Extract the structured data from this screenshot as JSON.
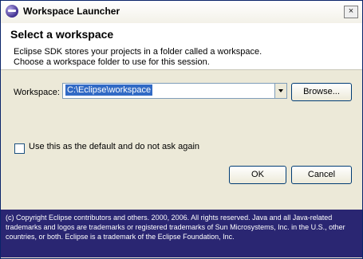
{
  "window": {
    "title": "Workspace Launcher",
    "close_symbol": "×"
  },
  "header": {
    "title": "Select a workspace",
    "line1": "Eclipse SDK stores your projects in a folder called a workspace.",
    "line2": "Choose a workspace folder to use for this session."
  },
  "form": {
    "workspace_label": "Workspace:",
    "workspace_value": "C:\\Eclipse\\workspace",
    "browse_label": "Browse...",
    "default_checkbox_label": "Use this as the default and do not ask again",
    "default_checked": false
  },
  "actions": {
    "ok_label": "OK",
    "cancel_label": "Cancel"
  },
  "footer": {
    "text": "(c) Copyright Eclipse contributors and others. 2000, 2006. All rights reserved. Java and all Java-related trademarks and logos are trademarks or registered trademarks of Sun Microsystems, Inc. in the U.S., other countries, or both. Eclipse is a trademark of the Eclipse Foundation, Inc."
  },
  "colors": {
    "selection": "#316ac5",
    "footer_bg": "#2a2672"
  }
}
